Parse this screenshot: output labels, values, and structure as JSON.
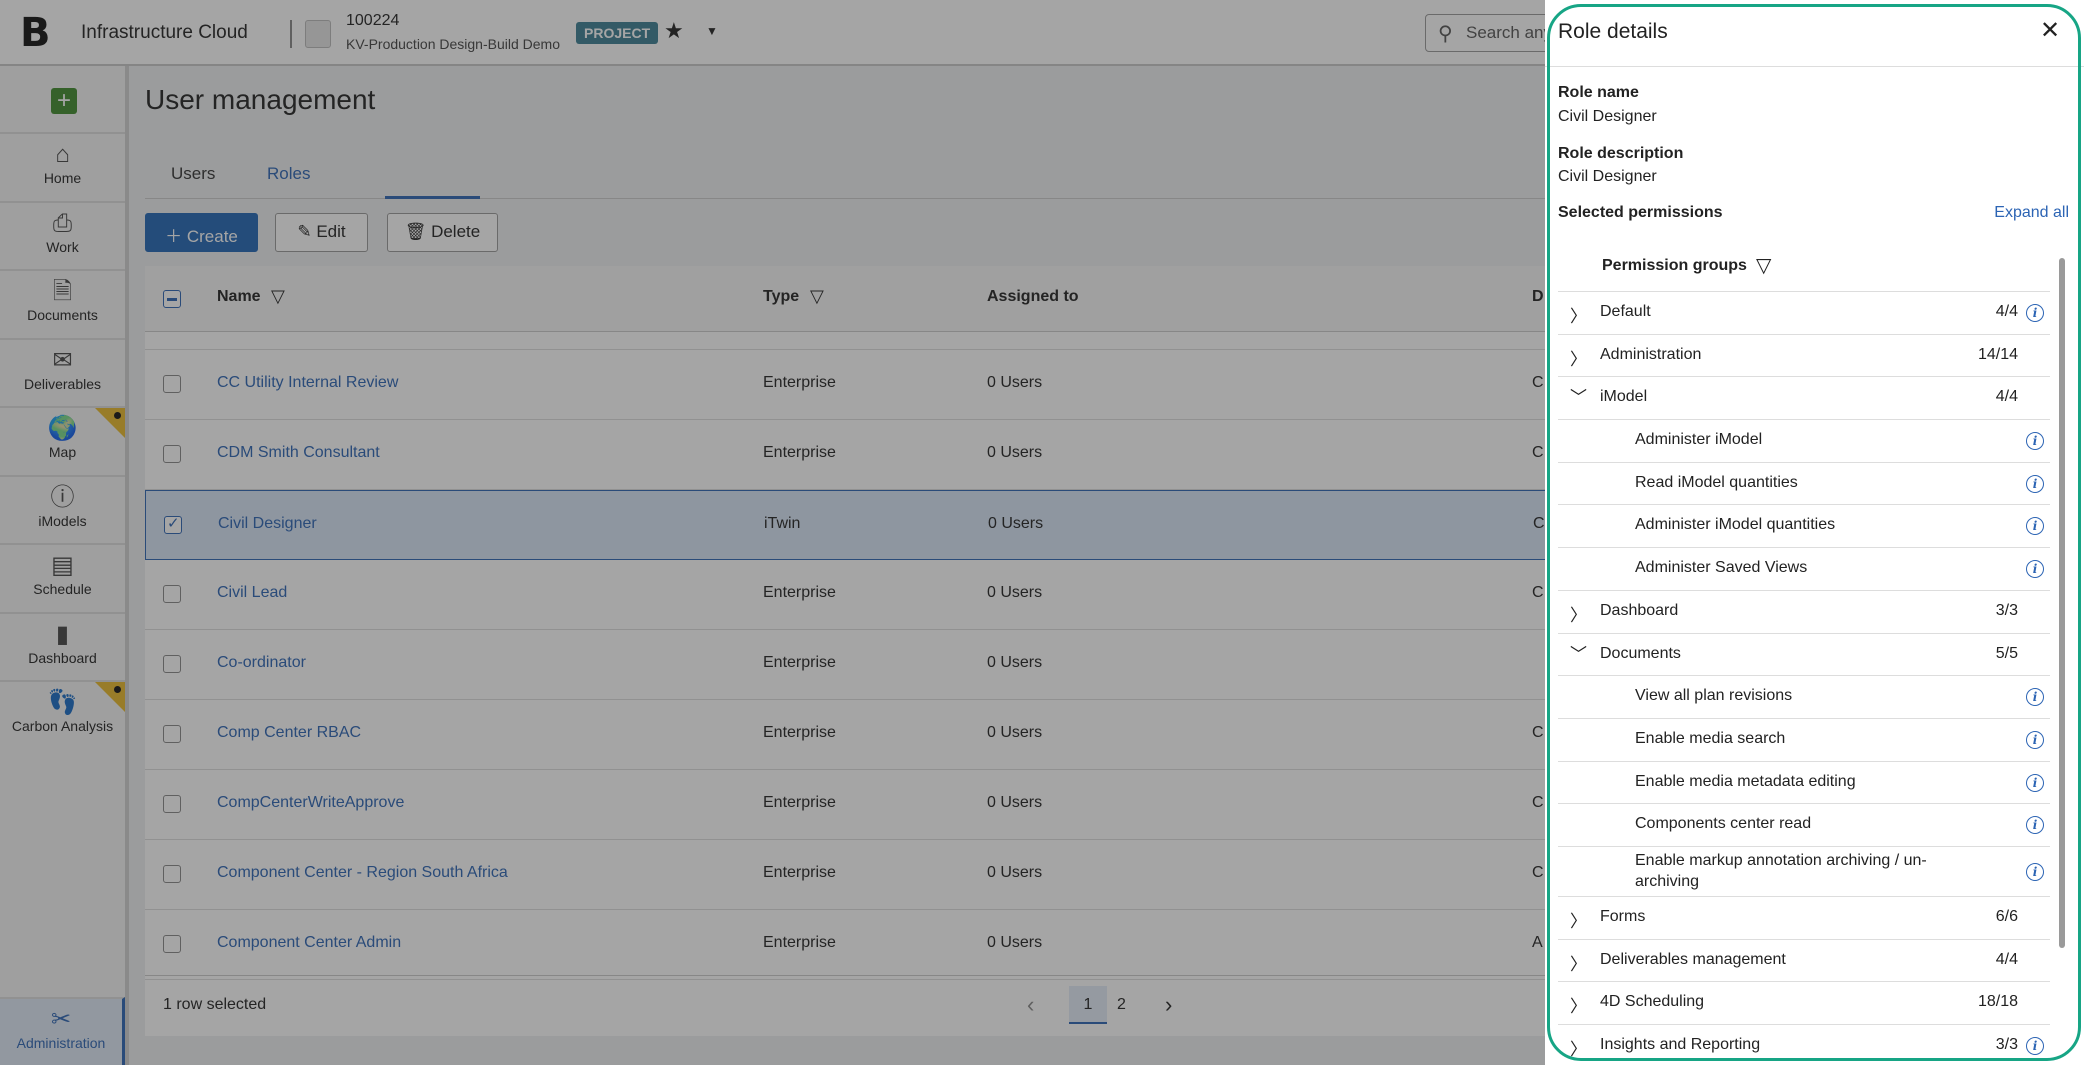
{
  "header": {
    "logo": "B",
    "app_title": "Infrastructure Cloud",
    "project_number": "100224",
    "project_name": "KV-Production Design-Build Demo",
    "badge": "PROJECT",
    "search_placeholder": "Search any"
  },
  "sidebar": {
    "items": [
      {
        "label": "Home",
        "icon": "⌂"
      },
      {
        "label": "Work",
        "icon": "⎙"
      },
      {
        "label": "Documents",
        "icon": "🗎"
      },
      {
        "label": "Deliverables",
        "icon": "✉"
      },
      {
        "label": "Map",
        "icon": "🌍",
        "flag": true
      },
      {
        "label": "iModels",
        "icon": "ⓘ"
      },
      {
        "label": "Schedule",
        "icon": "▤"
      },
      {
        "label": "Dashboard",
        "icon": "▮"
      },
      {
        "label": "Carbon Analysis",
        "icon": "👣",
        "flag": true
      }
    ],
    "active": {
      "label": "Administration",
      "icon": "✂"
    }
  },
  "page": {
    "title": "User management",
    "tabs": [
      "Users",
      "Roles"
    ],
    "active_tab": "Roles",
    "buttons": {
      "create": "Create",
      "edit": "Edit",
      "delete": "Delete"
    }
  },
  "table": {
    "columns": [
      "Name",
      "Type",
      "Assigned to",
      "D"
    ],
    "rows": [
      {
        "name": "CC Utility Internal Review",
        "type": "Enterprise",
        "assigned": "0 Users",
        "desc": "C",
        "selected": false
      },
      {
        "name": "CDM Smith Consultant",
        "type": "Enterprise",
        "assigned": "0 Users",
        "desc": "C",
        "selected": false
      },
      {
        "name": "Civil Designer",
        "type": "iTwin",
        "assigned": "0 Users",
        "desc": "C",
        "selected": true
      },
      {
        "name": "Civil Lead",
        "type": "Enterprise",
        "assigned": "0 Users",
        "desc": "C",
        "selected": false
      },
      {
        "name": "Co-ordinator",
        "type": "Enterprise",
        "assigned": "0 Users",
        "desc": "",
        "selected": false
      },
      {
        "name": "Comp Center RBAC",
        "type": "Enterprise",
        "assigned": "0 Users",
        "desc": "C",
        "selected": false
      },
      {
        "name": "CompCenterWriteApprove",
        "type": "Enterprise",
        "assigned": "0 Users",
        "desc": "C",
        "selected": false
      },
      {
        "name": "Component Center - Region South Africa",
        "type": "Enterprise",
        "assigned": "0 Users",
        "desc": "C",
        "selected": false
      },
      {
        "name": "Component Center Admin",
        "type": "Enterprise",
        "assigned": "0 Users",
        "desc": "A",
        "selected": false
      }
    ],
    "footer": {
      "selection": "1 row selected",
      "pages": [
        "1",
        "2"
      ],
      "current_page": "1"
    }
  },
  "panel": {
    "title": "Role details",
    "role_name_label": "Role name",
    "role_name": "Civil Designer",
    "role_desc_label": "Role description",
    "role_desc": "Civil Designer",
    "selected_label": "Selected permissions",
    "expand_all": "Expand all",
    "groups_header": "Permission groups",
    "permissions": [
      {
        "label": "Default",
        "count": "4/4",
        "level": 0,
        "expanded": false,
        "info": true
      },
      {
        "label": "Administration",
        "count": "14/14",
        "level": 0,
        "expanded": false,
        "info": false
      },
      {
        "label": "iModel",
        "count": "4/4",
        "level": 0,
        "expanded": true,
        "info": false
      },
      {
        "label": "Administer iModel",
        "level": 1,
        "info": true
      },
      {
        "label": "Read iModel quantities",
        "level": 1,
        "info": true
      },
      {
        "label": "Administer iModel quantities",
        "level": 1,
        "info": true
      },
      {
        "label": "Administer Saved Views",
        "level": 1,
        "info": true
      },
      {
        "label": "Dashboard",
        "count": "3/3",
        "level": 0,
        "expanded": false,
        "info": false
      },
      {
        "label": "Documents",
        "count": "5/5",
        "level": 0,
        "expanded": true,
        "info": false
      },
      {
        "label": "View all plan revisions",
        "level": 1,
        "info": true
      },
      {
        "label": "Enable media search",
        "level": 1,
        "info": true
      },
      {
        "label": "Enable media metadata editing",
        "level": 1,
        "info": true
      },
      {
        "label": "Components center read",
        "level": 1,
        "info": true
      },
      {
        "label": "Enable markup annotation archiving / un-archiving",
        "level": 1,
        "info": true,
        "tall": true
      },
      {
        "label": "Forms",
        "count": "6/6",
        "level": 0,
        "expanded": false,
        "info": false
      },
      {
        "label": "Deliverables management",
        "count": "4/4",
        "level": 0,
        "expanded": false,
        "info": false
      },
      {
        "label": "4D Scheduling",
        "count": "18/18",
        "level": 0,
        "expanded": false,
        "info": false
      },
      {
        "label": "Insights and Reporting",
        "count": "3/3",
        "level": 0,
        "expanded": false,
        "info": true
      }
    ]
  },
  "colors": {
    "accent": "#2c64b4",
    "highlight_ring": "#17a585",
    "badge": "#3b7f93",
    "create": "#2166b5"
  }
}
